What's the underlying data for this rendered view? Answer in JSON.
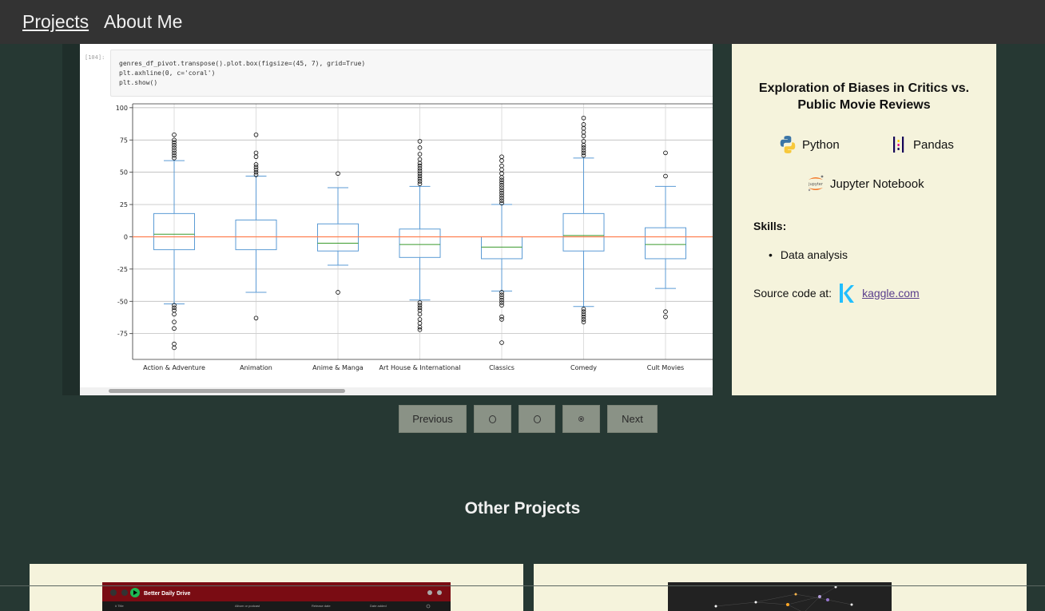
{
  "nav": {
    "projects": "Projects",
    "about": "About Me"
  },
  "notebook": {
    "prompt": "[104]:",
    "code": [
      "genres_df_pivot.transpose().plot.box(figsize=(45, 7), grid=True)",
      "plt.axhline(0, c='coral')",
      "plt.show()"
    ]
  },
  "project": {
    "title": "Exploration of Biases in Critics vs. Public Movie Reviews",
    "tech": [
      {
        "name": "Python",
        "icon": "python-icon"
      },
      {
        "name": "Pandas",
        "icon": "pandas-icon"
      },
      {
        "name": "Jupyter Notebook",
        "icon": "jupyter-icon"
      }
    ],
    "skills_label": "Skills:",
    "skills": [
      "Data analysis"
    ],
    "source_label": "Source code at:",
    "source_link": "kaggle.com"
  },
  "pager": {
    "previous": "Previous",
    "next": "Next",
    "dots": 3,
    "active_dot": 3
  },
  "other": {
    "title": "Other Projects",
    "card1_app_title": "Better Daily Drive",
    "card1_columns": [
      "#  Title",
      "Album or podcast",
      "Release date",
      "Date added"
    ]
  },
  "colors": {
    "background": "#263833",
    "navbar": "#333333",
    "card": "#f5f3dc",
    "box": "#5b9bd5",
    "median": "#3a9a2c",
    "reference_line": "coral"
  },
  "chart_data": {
    "type": "box",
    "categories": [
      "Action & Adventure",
      "Animation",
      "Anime & Manga",
      "Art House & International",
      "Classics",
      "Comedy",
      "Cult Movies"
    ],
    "yticks": [
      100,
      75,
      50,
      25,
      0,
      -25,
      -50,
      -75
    ],
    "ylim": [
      -95,
      103
    ],
    "grid": true,
    "hline": 0,
    "boxes": [
      {
        "whislo": -52,
        "q1": -10,
        "med": 2,
        "q3": 18,
        "whishi": 59,
        "fliers": [
          61,
          63,
          65,
          67,
          69,
          71,
          73,
          75,
          79,
          -53,
          -55,
          -57,
          -60,
          -66,
          -71,
          -83,
          -86
        ]
      },
      {
        "whislo": -43,
        "q1": -10,
        "med": 0,
        "q3": 13,
        "whishi": 47,
        "fliers": [
          48,
          50,
          52,
          54,
          56,
          62,
          65,
          79,
          -63
        ]
      },
      {
        "whislo": -22,
        "q1": -11,
        "med": -5,
        "q3": 10,
        "whishi": 38,
        "fliers": [
          49,
          -43
        ]
      },
      {
        "whislo": -49,
        "q1": -16,
        "med": -6,
        "q3": 6,
        "whishi": 39,
        "fliers": [
          41,
          43,
          45,
          47,
          49,
          51,
          53,
          55,
          57,
          60,
          64,
          69,
          74,
          -51,
          -53,
          -55,
          -57,
          -60,
          -64,
          -67,
          -70,
          -72
        ]
      },
      {
        "whislo": -42,
        "q1": -17,
        "med": -8,
        "q3": 0,
        "whishi": 25,
        "fliers": [
          26,
          28,
          30,
          32,
          34,
          36,
          38,
          40,
          42,
          44,
          46,
          49,
          52,
          55,
          59,
          62,
          -43,
          -45,
          -47,
          -49,
          -51,
          -53,
          -62,
          -64,
          -82
        ]
      },
      {
        "whislo": -54,
        "q1": -11,
        "med": 1,
        "q3": 18,
        "whishi": 61,
        "fliers": [
          63,
          65,
          67,
          69,
          71,
          74,
          78,
          81,
          84,
          87,
          92,
          -56,
          -58,
          -60,
          -62,
          -64,
          -66
        ]
      },
      {
        "whislo": -40,
        "q1": -17,
        "med": -6,
        "q3": 7,
        "whishi": 39,
        "fliers": [
          47,
          65,
          -58,
          -62
        ]
      }
    ]
  }
}
